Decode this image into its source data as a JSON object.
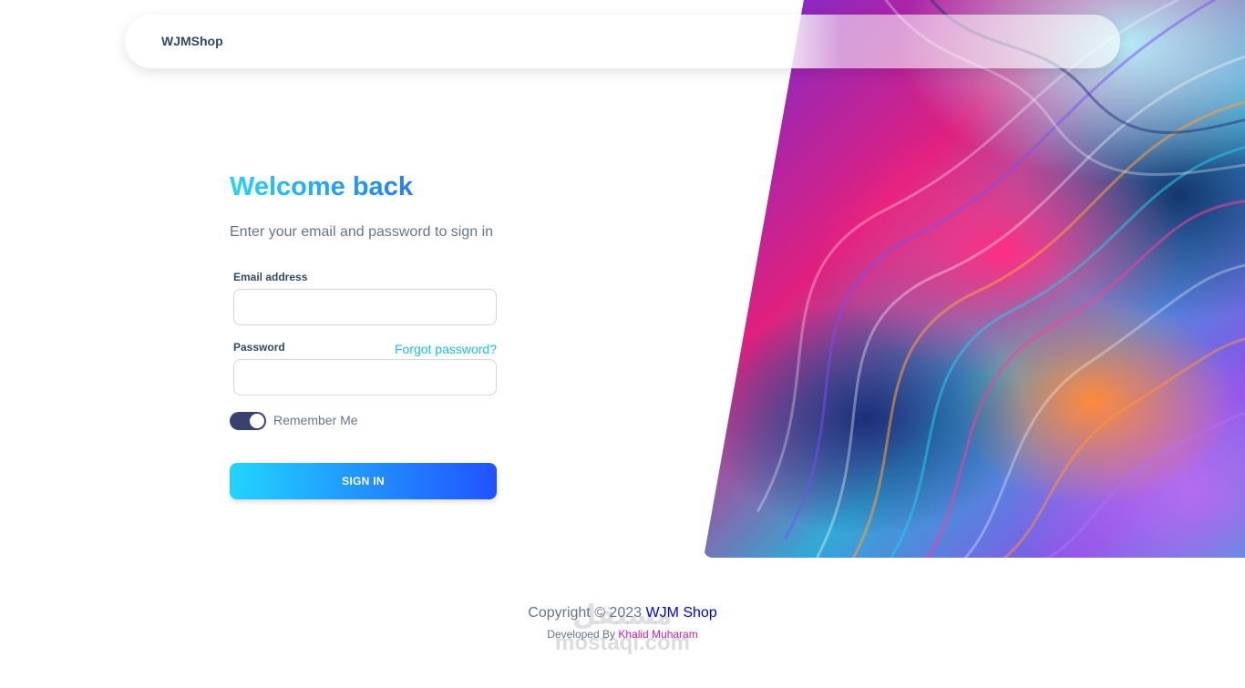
{
  "navbar": {
    "brand": "WJMShop"
  },
  "signin": {
    "title": "Welcome back",
    "subtitle": "Enter your email and password to sign in",
    "email_label": "Email address",
    "email_value": "",
    "password_label": "Password",
    "password_value": "",
    "forgot_link": "Forgot password?",
    "remember_label": "Remember Me",
    "remember_checked": true,
    "submit_label": "SIGN IN"
  },
  "footer": {
    "copyright_prefix": "Copyright © 2023",
    "copyright_link": "WJM Shop",
    "developer_prefix": "Developed By",
    "developer_link": "Khalid Muharam"
  },
  "watermark": {
    "glyph": "مستقل",
    "text": "mostaql.com"
  },
  "colors": {
    "gradient_start": "#21d4fd",
    "gradient_end": "#2152ff",
    "heading": "#344767",
    "muted_text": "#67748e",
    "link_cyan": "#17c1e8",
    "toggle_on": "#3a416f",
    "developer_link": "#c71fb0"
  }
}
